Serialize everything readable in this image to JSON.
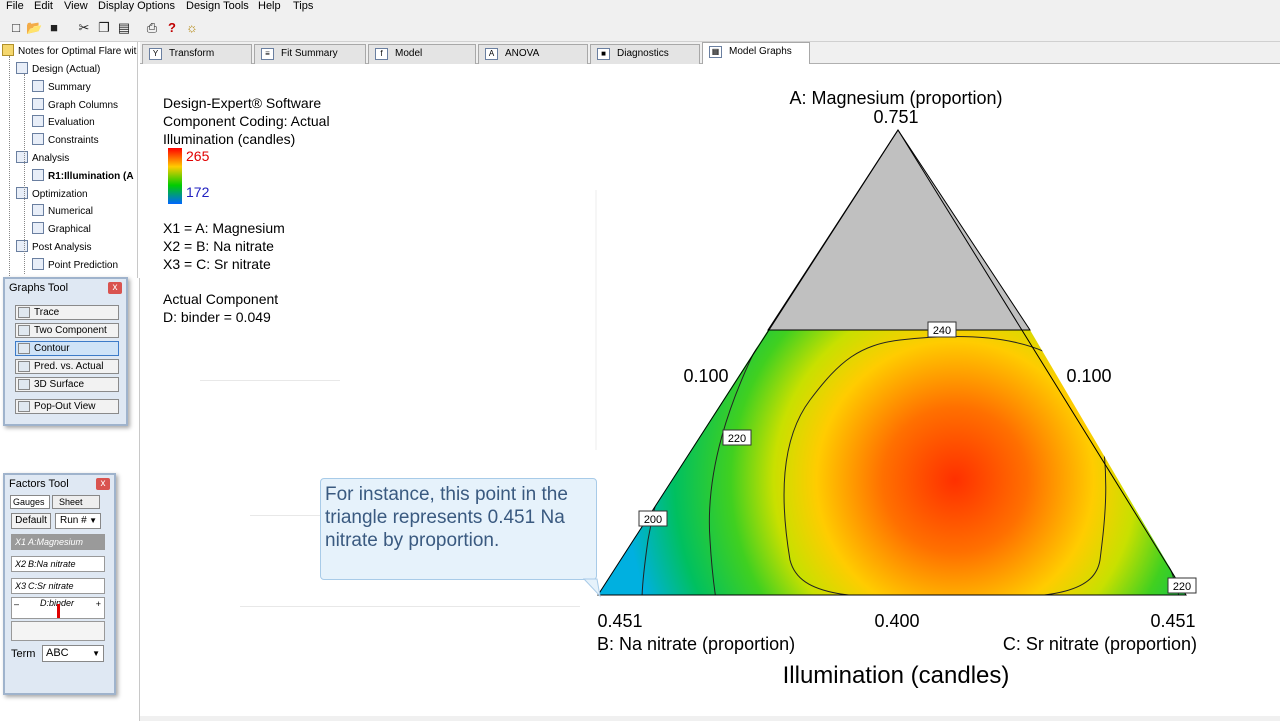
{
  "menu": [
    "File",
    "Edit",
    "View",
    "Display Options",
    "Design Tools",
    "Help",
    "Tips"
  ],
  "toolbar_icons": [
    "new-file-icon",
    "open-folder-icon",
    "save-icon",
    "cut-icon",
    "copy-icon",
    "paste-icon",
    "print-icon",
    "help-icon",
    "tip-bulb-icon"
  ],
  "tree": {
    "root": "Notes for Optimal Flare wit",
    "items": [
      {
        "label": "Design (Actual)",
        "level": 1,
        "bold": false
      },
      {
        "label": "Summary",
        "level": 2,
        "bold": false
      },
      {
        "label": "Graph Columns",
        "level": 2,
        "bold": false
      },
      {
        "label": "Evaluation",
        "level": 2,
        "bold": false
      },
      {
        "label": "Constraints",
        "level": 2,
        "bold": false
      },
      {
        "label": "Analysis",
        "level": 1,
        "bold": false
      },
      {
        "label": "R1:Illumination (A",
        "level": 2,
        "bold": true
      },
      {
        "label": "Optimization",
        "level": 1,
        "bold": false
      },
      {
        "label": "Numerical",
        "level": 2,
        "bold": false
      },
      {
        "label": "Graphical",
        "level": 2,
        "bold": false
      },
      {
        "label": "Post Analysis",
        "level": 1,
        "bold": false
      },
      {
        "label": "Point Prediction",
        "level": 2,
        "bold": false
      }
    ]
  },
  "graphs_tool": {
    "title": "Graphs Tool",
    "close": "x",
    "buttons": [
      "Trace",
      "Two Component",
      "Contour",
      "Pred. vs. Actual",
      "3D Surface",
      "Pop-Out View"
    ],
    "active": "Contour"
  },
  "factors_tool": {
    "title": "Factors Tool",
    "close": "x",
    "tab_gauges": "Gauges",
    "tab_sheet": "Sheet",
    "default_label": "Default",
    "run_select": "Run #",
    "factors": [
      {
        "code": "X1",
        "name": "A:Magnesium",
        "selected": true
      },
      {
        "code": "X2",
        "name": "B:Na nitrate",
        "selected": false
      },
      {
        "code": "X3",
        "name": "C:Sr nitrate",
        "selected": false
      }
    ],
    "slider_label": "D:binder",
    "slider_minus": "–",
    "slider_plus": "+",
    "slider_value": 0.5,
    "term_label": "Term",
    "term_value": "ABC"
  },
  "tabs": [
    {
      "label": "Transform",
      "icon": "transform-icon",
      "active": false
    },
    {
      "label": "Fit Summary",
      "icon": "fit-summary-icon",
      "active": false
    },
    {
      "label": "Model",
      "icon": "model-icon",
      "active": false
    },
    {
      "label": "ANOVA",
      "icon": "anova-icon",
      "active": false
    },
    {
      "label": "Diagnostics",
      "icon": "diagnostics-icon",
      "active": false
    },
    {
      "label": "Model Graphs",
      "icon": "model-graphs-icon",
      "active": true
    }
  ],
  "legend": {
    "line1": "Design-Expert® Software",
    "line2": "Component Coding: Actual",
    "line3": "Illumination (candles)",
    "max": "265",
    "min": "172",
    "x1": "X1 = A: Magnesium",
    "x2": "X2 = B: Na nitrate",
    "x3": "X3 = C: Sr nitrate",
    "actual_label": "Actual Component",
    "actual_value": "D: binder = 0.049"
  },
  "callout": "For instance, this point in the triangle represents 0.451 Na nitrate  by proportion.",
  "chart_data": {
    "type": "contour",
    "title": "",
    "top_axis": "A: Magnesium (proportion)",
    "top_value": "0.751",
    "left_mid": "0.100",
    "right_mid": "0.100",
    "bottom_left_value": "0.451",
    "bottom_mid_value": "0.400",
    "bottom_right_value": "0.451",
    "bottom_left_axis": "B: Na nitrate (proportion)",
    "bottom_right_axis": "C: Sr nitrate (proportion)",
    "response_label": "Illumination (candles)",
    "contour_levels": [
      "240",
      "220",
      "200",
      "220"
    ],
    "response_range": [
      172,
      265
    ],
    "colors": {
      "high": "#ff0000",
      "mid_high": "#ffcc00",
      "mid": "#00cc00",
      "low": "#0066ff",
      "excluded": "#c0c0c0"
    }
  }
}
